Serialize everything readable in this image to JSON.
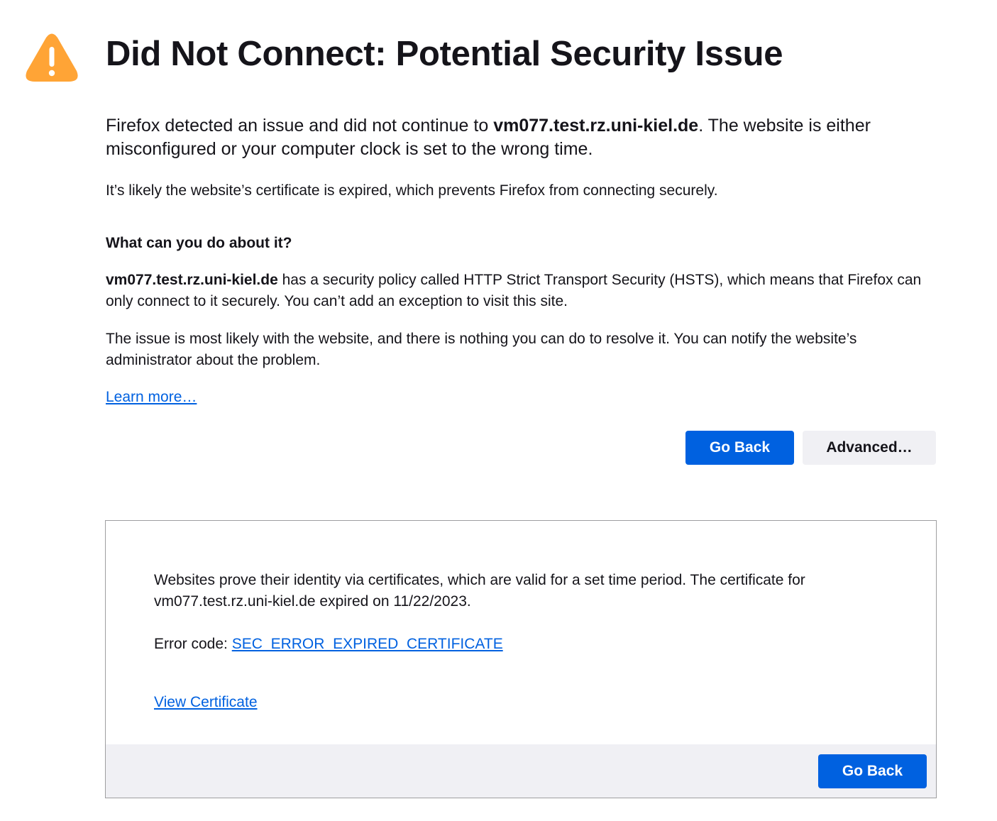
{
  "page": {
    "title": "Did Not Connect: Potential Security Issue",
    "icon": "warning-triangle-icon",
    "icon_color": "#ffa436"
  },
  "intro": {
    "prefix": "Firefox detected an issue and did not continue to ",
    "host": "vm077.test.rz.uni-kiel.de",
    "suffix": ". The website is either misconfigured or your computer clock is set to the wrong time."
  },
  "likely_text": "It’s likely the website’s certificate is expired, which prevents Firefox from connecting securely.",
  "what_to_do": {
    "heading": "What can you do about it?",
    "hsts_host": "vm077.test.rz.uni-kiel.de",
    "hsts_text": " has a security policy called HTTP Strict Transport Security (HSTS), which means that Firefox can only connect to it securely. You can’t add an exception to visit this site.",
    "issue_text": "The issue is most likely with the website, and there is nothing you can do to resolve it. You can notify the website’s administrator about the problem."
  },
  "learn_more": "Learn more…",
  "buttons": {
    "go_back": "Go Back",
    "advanced": "Advanced…"
  },
  "advanced_panel": {
    "description": "Websites prove their identity via certificates, which are valid for a set time period. The certificate for vm077.test.rz.uni-kiel.de expired on 11/22/2023.",
    "error_label": "Error code: ",
    "error_code": "SEC_ERROR_EXPIRED_CERTIFICATE",
    "view_certificate": "View Certificate",
    "go_back": "Go Back"
  },
  "colors": {
    "accent": "#0061e0",
    "secondary_button": "#f0f0f4",
    "text": "#15141a"
  }
}
